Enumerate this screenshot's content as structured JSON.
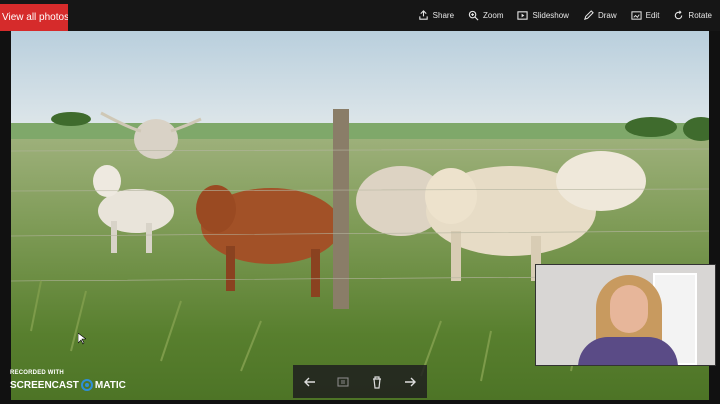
{
  "topbar": {
    "view_all_label": "View all photos",
    "tools": [
      {
        "label": "Share",
        "icon": "share-icon"
      },
      {
        "label": "Zoom",
        "icon": "zoom-icon"
      },
      {
        "label": "Slideshow",
        "icon": "slideshow-icon"
      },
      {
        "label": "Draw",
        "icon": "draw-icon"
      },
      {
        "label": "Edit",
        "icon": "edit-icon"
      },
      {
        "label": "Rotate",
        "icon": "rotate-icon"
      }
    ]
  },
  "watermark": {
    "recorded_with": "RECORDED WITH",
    "brand_left": "SCREENCAST",
    "brand_right": "MATIC"
  },
  "colors": {
    "accent": "#d62b2b",
    "toolbar_bg": "#161616",
    "brand_blue": "#2e8fd8"
  },
  "controls": [
    "previous-arrow-icon",
    "filmstrip-icon",
    "delete-icon",
    "next-arrow-icon"
  ]
}
